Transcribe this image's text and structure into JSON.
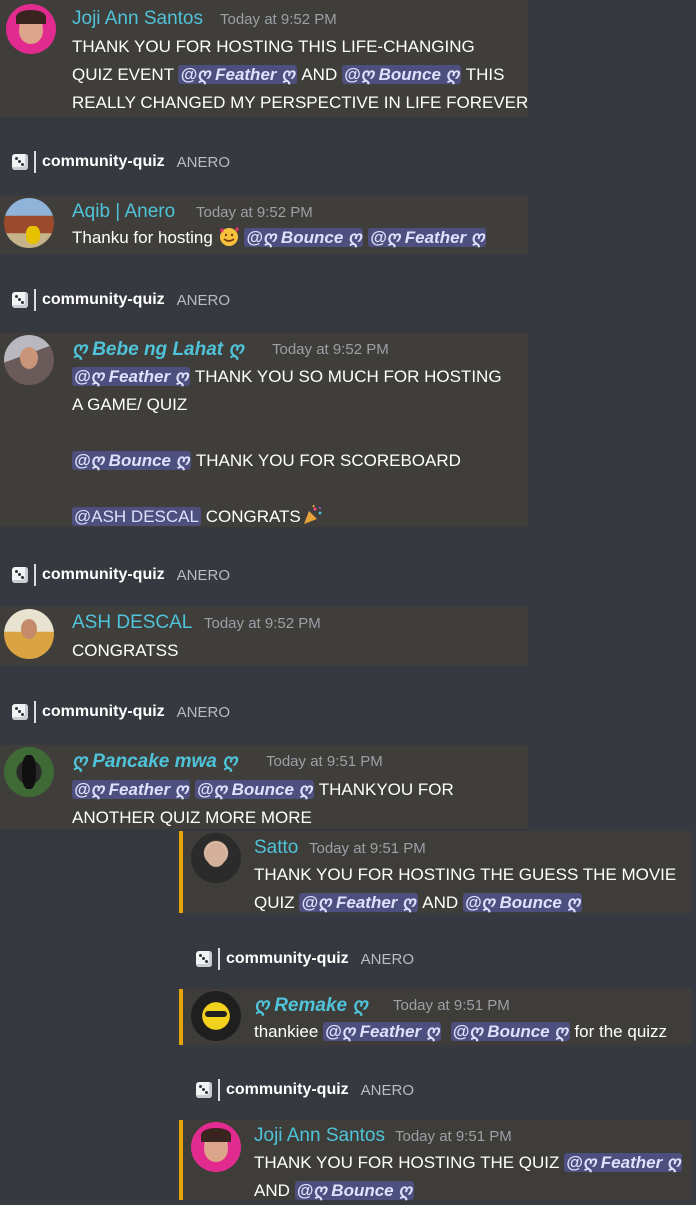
{
  "channel": {
    "name": "community-quiz",
    "server": "ANERO"
  },
  "mention_prefix": "@ღ",
  "mention_suffix": "ღ",
  "messages": [
    {
      "author": "Joji Ann Santos",
      "timestamp": "Today at 9:52 PM",
      "lines": [
        [
          "THANK YOU FOR HOSTING THIS LIFE-CHANGING"
        ],
        [
          "QUIZ EVENT ",
          "@ღ Feather ღ",
          " AND ",
          "@ღ Bounce ღ",
          " THIS"
        ],
        [
          "REALLY CHANGED MY PERSPECTIVE IN LIFE FOREVER"
        ]
      ]
    },
    {
      "author": "Aqib | Anero",
      "timestamp": "Today at 9:52 PM",
      "text_before": "Thanku for hosting ",
      "mention_a": "@ღ Bounce ღ",
      "mention_b": "@ღ Feather ღ"
    },
    {
      "author": "ღ Bebe ng Lahat ღ",
      "timestamp": "Today at 9:52 PM",
      "line1_mention": "@ღ Feather ღ",
      "line1_text": " THANK YOU SO MUCH FOR HOSTING",
      "line2_text": "A GAME/ QUIZ",
      "line3_mention": "@ღ Bounce ღ",
      "line3_text": " THANK YOU FOR SCOREBOARD",
      "line4_mention": "@ASH DESCAL",
      "line4_text": " CONGRATS"
    },
    {
      "author": "ASH DESCAL",
      "timestamp": "Today at 9:52 PM",
      "text": "CONGRATSS"
    },
    {
      "author": "ღ Pancake mwa ღ",
      "timestamp": "Today at 9:51 PM",
      "mention_a": "@ღ Feather ღ",
      "mention_b": "@ღ Bounce ღ",
      "line1_text": " THANKYOU FOR",
      "line2_text": "ANOTHER QUIZ MORE MORE"
    },
    {
      "author": "Satto",
      "timestamp": "Today at 9:51 PM",
      "line1_text": "THANK YOU FOR HOSTING THE GUESS THE MOVIE",
      "line2_text": "QUIZ ",
      "mention_a": "@ღ Feather ღ",
      "mid_text": " AND ",
      "mention_b": "@ღ Bounce ღ"
    },
    {
      "author": "ღ Remake ღ",
      "timestamp": "Today at 9:51 PM",
      "text_before": "thankiee ",
      "mention_a": "@ღ Feather ღ",
      "mention_b": "@ღ Bounce ღ",
      "text_after": " for the quizz"
    },
    {
      "author": "Joji Ann Santos",
      "timestamp": "Today at 9:51 PM",
      "line1_text": "THANK YOU FOR HOSTING THE QUIZ ",
      "mention_a": "@ღ Feather ღ",
      "line2_text": "AND ",
      "mention_b": "@ღ Bounce ღ"
    }
  ]
}
